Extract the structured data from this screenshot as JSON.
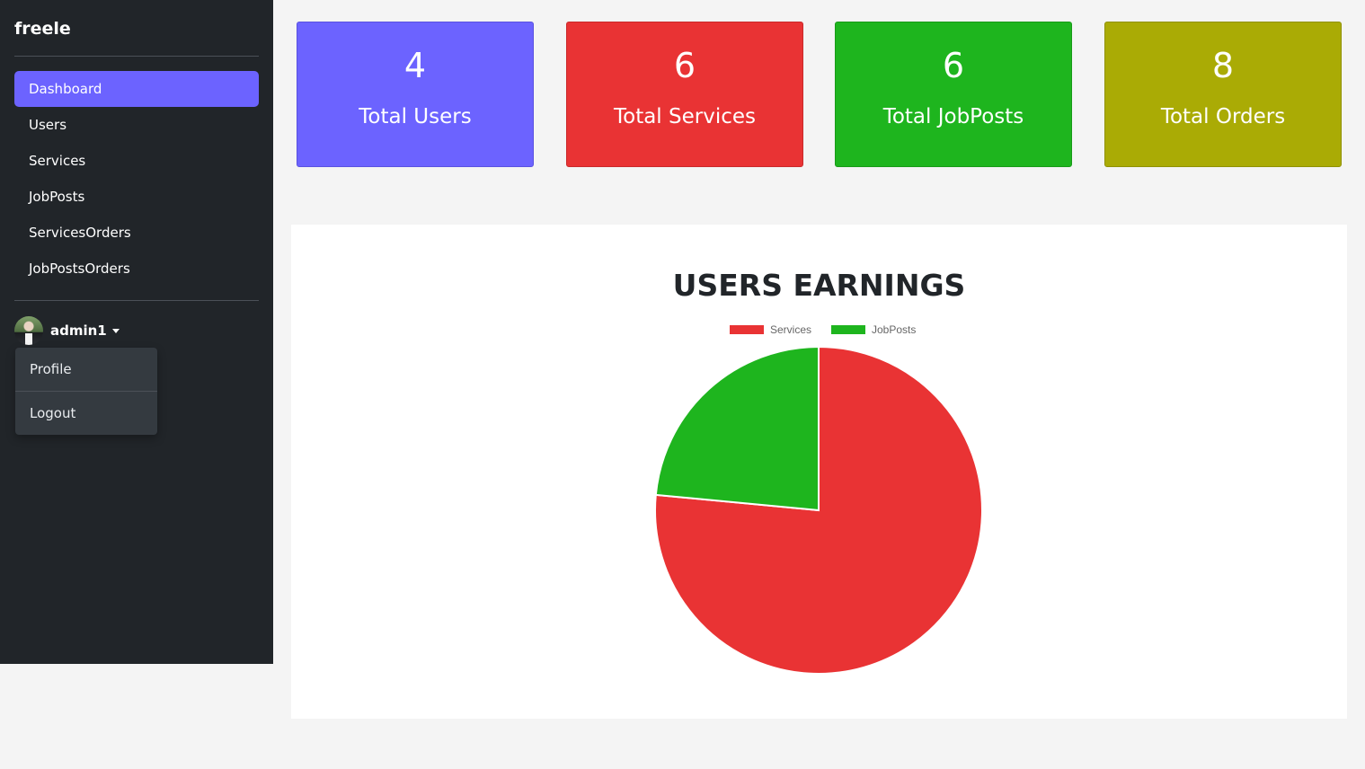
{
  "sidebar": {
    "brand": "freele",
    "items": [
      {
        "label": "Dashboard"
      },
      {
        "label": "Users"
      },
      {
        "label": "Services"
      },
      {
        "label": "JobPosts"
      },
      {
        "label": "ServicesOrders"
      },
      {
        "label": "JobPostsOrders"
      }
    ],
    "user": {
      "name": "admin1"
    },
    "dropdown": {
      "profile": "Profile",
      "logout": "Logout"
    }
  },
  "cards": [
    {
      "value": "4",
      "label": "Total Users",
      "color": "#6c63ff"
    },
    {
      "value": "6",
      "label": "Total Services",
      "color": "#e93334"
    },
    {
      "value": "6",
      "label": "Total JobPosts",
      "color": "#1eb51e"
    },
    {
      "value": "8",
      "label": "Total Orders",
      "color": "#aaab05"
    }
  ],
  "chart_data": {
    "type": "pie",
    "title": "USERS EARNINGS",
    "legend_position": "top",
    "series": [
      {
        "name": "Services",
        "value": 76.5,
        "color": "#e93334"
      },
      {
        "name": "JobPosts",
        "value": 23.5,
        "color": "#1eb51e"
      }
    ]
  }
}
